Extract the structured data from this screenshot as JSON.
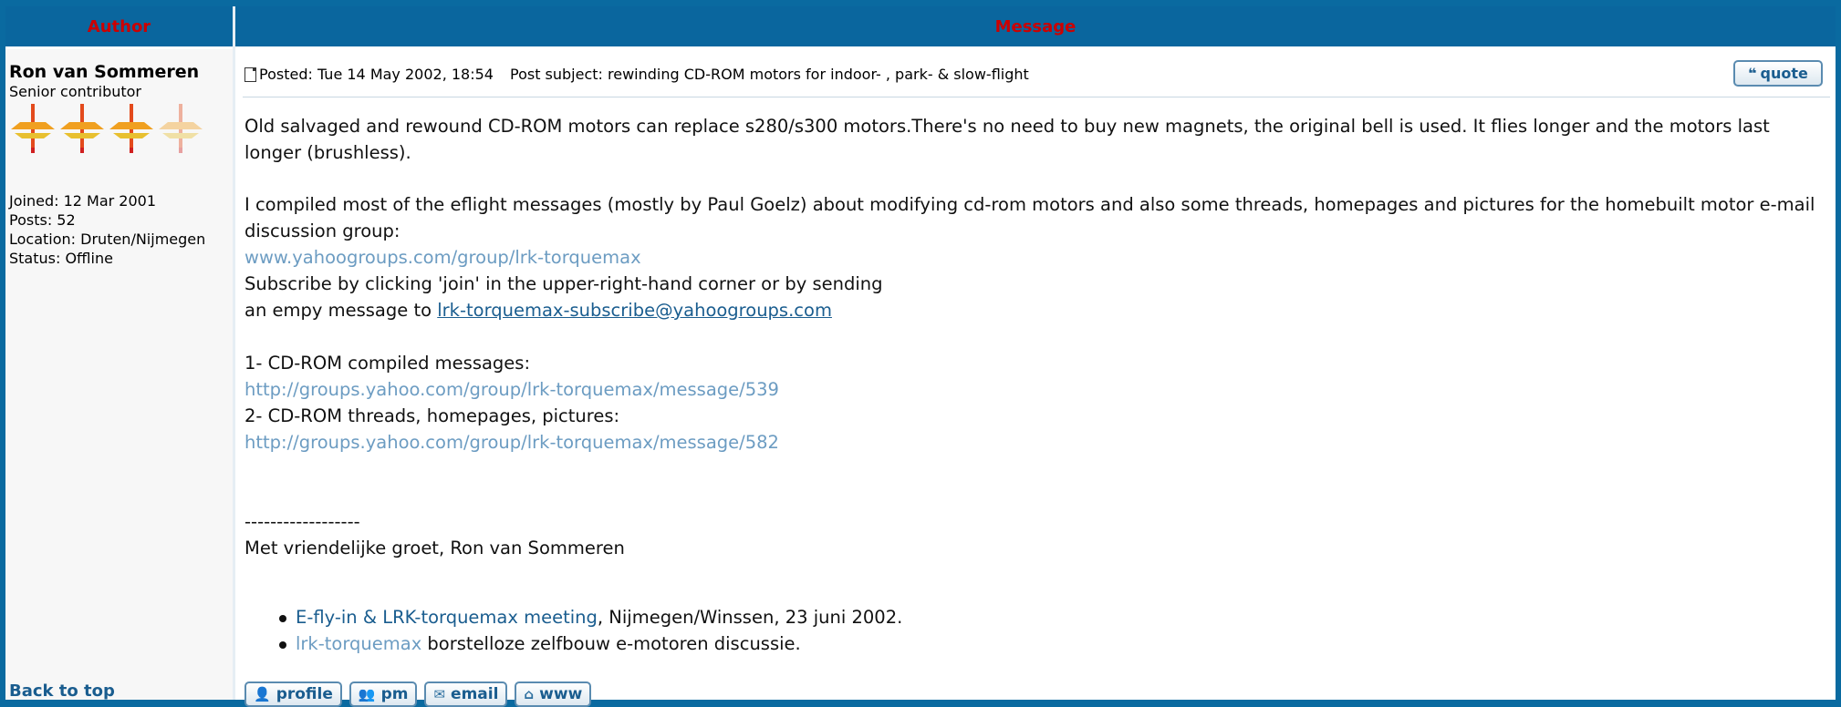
{
  "header": {
    "author_label": "Author",
    "message_label": "Message"
  },
  "author": {
    "name": "Ron van Sommeren",
    "rank": "Senior contributor",
    "joined": "Joined: 12 Mar 2001",
    "posts": "Posts: 52",
    "location": "Location: Druten/Nijmegen",
    "status": "Status: Offline",
    "back_to_top": "Back to top"
  },
  "post": {
    "posted": "Posted: Tue 14 May 2002, 18:54",
    "subject": "Post subject: rewinding CD-ROM motors for indoor- , park- & slow-flight",
    "quote_label": "quote",
    "para1": "Old salvaged and rewound CD-ROM motors can replace s280/s300 motors.There's no need to buy new magnets, the original bell is used. It flies longer and the motors last longer (brushless).",
    "para2": "I compiled most of the eflight messages (mostly by Paul Goelz) about modifying cd-rom motors and also some threads, homepages and pictures for the homebuilt motor e-mail discussion group:",
    "link_group": "www.yahoogroups.com/group/lrk-torquemax",
    "subscribe_line1": "Subscribe by clicking 'join' in the upper-right-hand corner or by sending",
    "subscribe_line2_prefix": "an empy message to ",
    "subscribe_email": "lrk-torquemax-subscribe@yahoogroups.com",
    "item1_label": "1- CD-ROM compiled messages:",
    "item1_link": "http://groups.yahoo.com/group/lrk-torquemax/message/539",
    "item2_label": "2- CD-ROM threads, homepages, pictures:",
    "item2_link": "http://groups.yahoo.com/group/lrk-torquemax/message/582",
    "sig_dashes": "------------------",
    "sig_greeting": "Met vriendelijke groet, Ron van Sommeren",
    "sig_items": [
      {
        "link": "E-fly-in & LRK-torquemax meeting",
        "text": ", Nijmegen/Winssen, 23 juni 2002."
      },
      {
        "link": "lrk-torquemax",
        "text": " borstelloze zelfbouw e-motoren discussie."
      }
    ]
  },
  "buttons": {
    "profile": "profile",
    "pm": "pm",
    "email": "email",
    "www": "www"
  },
  "colors": {
    "header_bg": "#0a669e",
    "header_text": "#cc0000",
    "link": "#1a5d8f",
    "link_light": "#6c9cc2"
  }
}
